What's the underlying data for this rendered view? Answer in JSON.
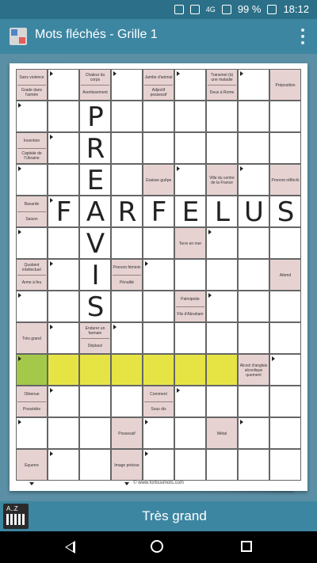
{
  "status": {
    "battery": "99 %",
    "time": "18:12",
    "network": "4G"
  },
  "app": {
    "title": "Mots fléchés - Grille 1"
  },
  "footer_url": "© www.fortissimots.com",
  "current_clue": "Très grand",
  "grid": {
    "defs": [
      {
        "c": 0,
        "r": 0,
        "t": [
          "Sans violence",
          "Grade dans l'armée"
        ]
      },
      {
        "c": 2,
        "r": 0,
        "t": [
          "Chaleur du corps",
          "Avertissement"
        ]
      },
      {
        "c": 4,
        "r": 0,
        "t": [
          "Jambe d'animal",
          "Adjectif possessif"
        ]
      },
      {
        "c": 6,
        "r": 0,
        "t": [
          "Transmet (à) une maladie",
          "Deux à Rome"
        ]
      },
      {
        "c": 8,
        "r": 0,
        "t": [
          "Préposition"
        ]
      },
      {
        "c": 0,
        "r": 2,
        "t": [
          "Invention",
          "Capitale de l'Ukraine"
        ]
      },
      {
        "c": 4,
        "r": 3,
        "t": [
          "Graisse guêpe"
        ]
      },
      {
        "c": 6,
        "r": 3,
        "t": [
          "Ville du centre de la France"
        ]
      },
      {
        "c": 8,
        "r": 3,
        "t": [
          "Pronom réfléchi"
        ]
      },
      {
        "c": 0,
        "r": 4,
        "t": [
          "Bavarde",
          "Saison"
        ]
      },
      {
        "c": 5,
        "r": 5,
        "t": [
          "Terre en mer"
        ]
      },
      {
        "c": 0,
        "r": 6,
        "t": [
          "Quotient intellectuel",
          "Arme à feu"
        ]
      },
      {
        "c": 3,
        "r": 6,
        "t": [
          "Pronom féminin",
          "Pénalité"
        ]
      },
      {
        "c": 8,
        "r": 6,
        "t": [
          "Attend"
        ]
      },
      {
        "c": 5,
        "r": 7,
        "t": [
          "Palmipède",
          "Fils d'Abraham"
        ]
      },
      {
        "c": 0,
        "r": 8,
        "t": [
          "Très grand"
        ]
      },
      {
        "c": 2,
        "r": 8,
        "t": [
          "Endurer un farmain",
          "Déplacé"
        ]
      },
      {
        "c": 7,
        "r": 9,
        "t": [
          "Alcool d'anglais alcoolique quement"
        ]
      },
      {
        "c": 0,
        "r": 10,
        "t": [
          "Obtenue",
          "Possédée"
        ]
      },
      {
        "c": 4,
        "r": 10,
        "t": [
          "Comment",
          "Sous dix"
        ]
      },
      {
        "c": 3,
        "r": 11,
        "t": [
          "Possessif"
        ]
      },
      {
        "c": 6,
        "r": 11,
        "t": [
          "Métal"
        ]
      },
      {
        "c": 0,
        "r": 12,
        "t": [
          "Équerre"
        ]
      },
      {
        "c": 3,
        "r": 12,
        "t": [
          "Image précise"
        ]
      }
    ],
    "letters": [
      {
        "c": 2,
        "r": 1,
        "ch": "P"
      },
      {
        "c": 2,
        "r": 2,
        "ch": "R"
      },
      {
        "c": 2,
        "r": 3,
        "ch": "E"
      },
      {
        "c": 2,
        "r": 4,
        "ch": "A"
      },
      {
        "c": 2,
        "r": 5,
        "ch": "V"
      },
      {
        "c": 2,
        "r": 6,
        "ch": "I"
      },
      {
        "c": 2,
        "r": 7,
        "ch": "S"
      },
      {
        "c": 1,
        "r": 4,
        "ch": "F"
      },
      {
        "c": 3,
        "r": 4,
        "ch": "R"
      },
      {
        "c": 4,
        "r": 4,
        "ch": "F"
      },
      {
        "c": 5,
        "r": 4,
        "ch": "E"
      },
      {
        "c": 6,
        "r": 4,
        "ch": "L"
      },
      {
        "c": 7,
        "r": 4,
        "ch": "U"
      },
      {
        "c": 8,
        "r": 4,
        "ch": "S"
      }
    ],
    "selected": [
      {
        "c": 1,
        "r": 9
      },
      {
        "c": 2,
        "r": 9
      },
      {
        "c": 3,
        "r": 9
      },
      {
        "c": 4,
        "r": 9
      },
      {
        "c": 5,
        "r": 9
      },
      {
        "c": 6,
        "r": 9
      }
    ],
    "current": {
      "c": 0,
      "r": 9
    }
  }
}
